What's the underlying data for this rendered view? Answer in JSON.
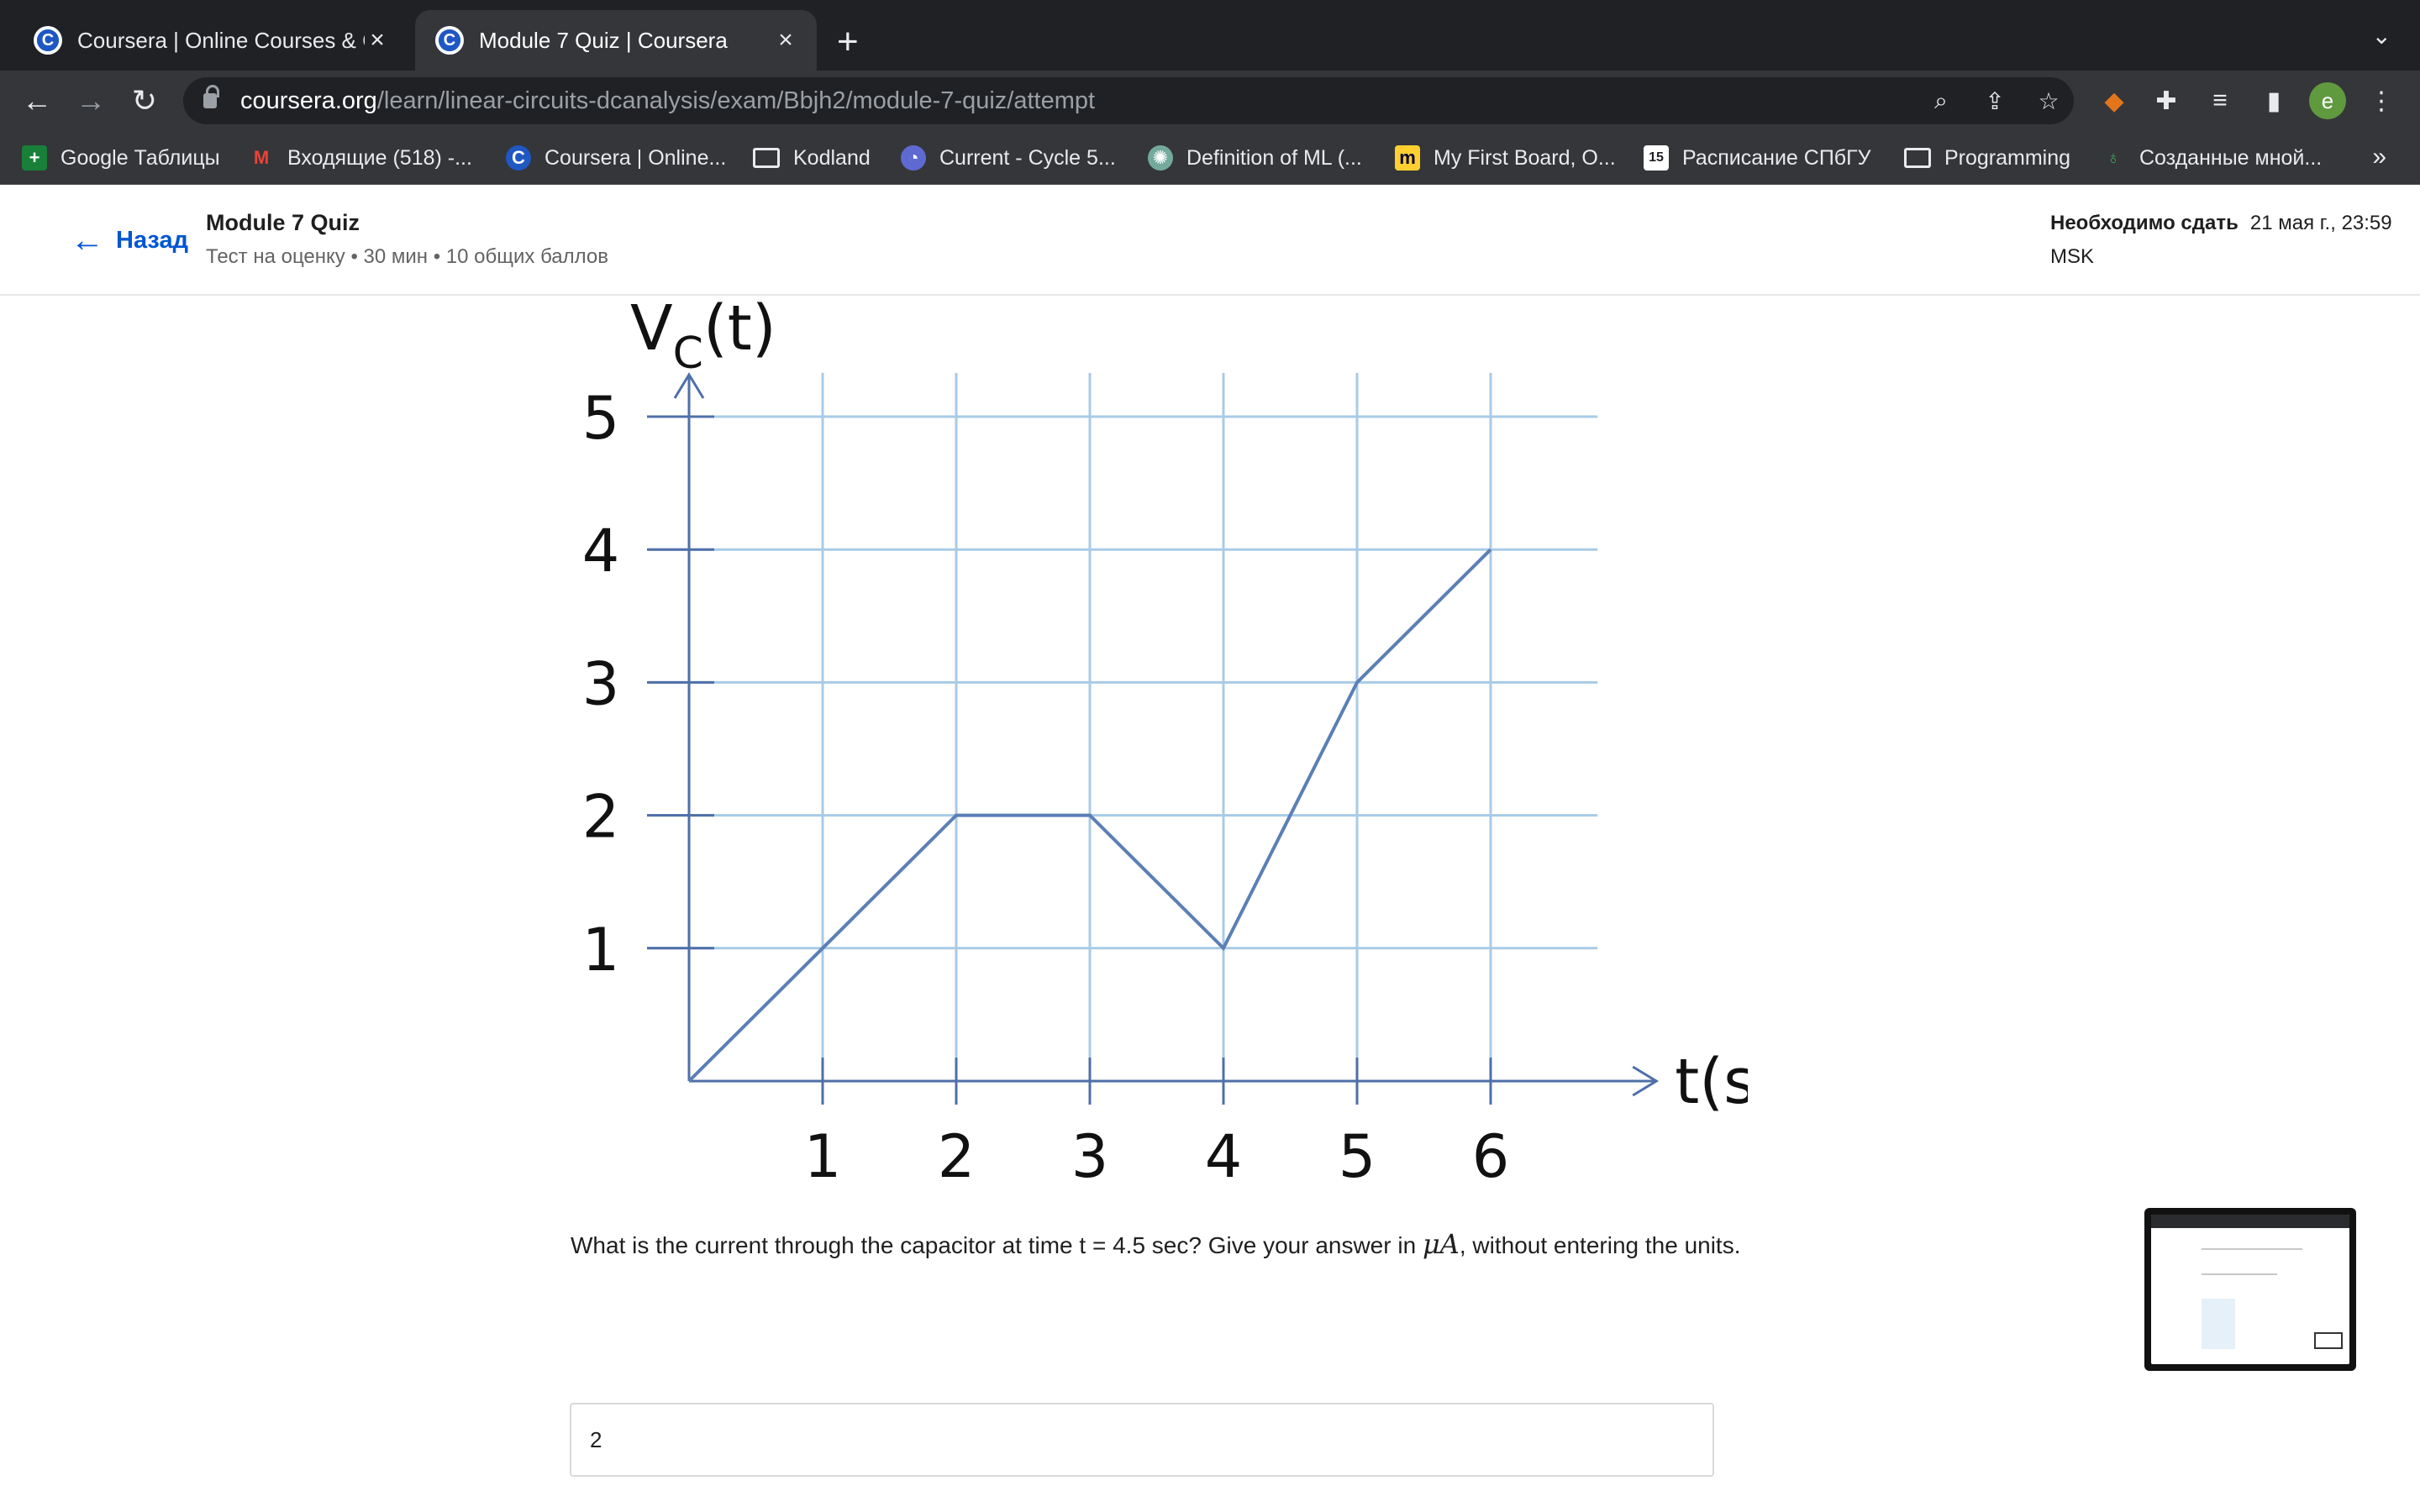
{
  "browser": {
    "tabs": [
      {
        "title": "Coursera | Online Courses & Cr",
        "active": false,
        "favicon": "coursera-icon"
      },
      {
        "title": "Module 7 Quiz | Coursera",
        "active": true,
        "favicon": "coursera-icon"
      }
    ],
    "new_tab_label": "+",
    "url_host": "coursera.org",
    "url_path": "/learn/linear-circuits-dcanalysis/exam/Bbjh2/module-7-quiz/attempt",
    "profile_initial": "e",
    "bookmarks": [
      {
        "label": "Google Таблицы",
        "icon": "sheets-icon"
      },
      {
        "label": "Входящие (518) -...",
        "icon": "gmail-icon"
      },
      {
        "label": "Coursera | Online...",
        "icon": "coursera-icon"
      },
      {
        "label": "Kodland",
        "icon": "folder-icon"
      },
      {
        "label": "Current - Cycle 5...",
        "icon": "linear-icon"
      },
      {
        "label": "Definition of ML (...",
        "icon": "openai-icon"
      },
      {
        "label": "My First Board, O...",
        "icon": "miro-icon"
      },
      {
        "label": "Расписание СПбГУ",
        "icon": "calendar-icon"
      },
      {
        "label": "Programming",
        "icon": "folder-icon"
      },
      {
        "label": "Созданные мной...",
        "icon": "leaf-icon"
      }
    ],
    "bookmarks_more": "»"
  },
  "header": {
    "back_label": "Назад",
    "quiz_title": "Module 7 Quiz",
    "quiz_meta": "Тест на оценку • 30 мин • 10 общих баллов",
    "due_label": "Необходимо сдать",
    "due_date": "21 мая г., 23:59",
    "due_tz": "MSK"
  },
  "question": {
    "text_before": "What is the current through the capacitor at time t = 4.5 sec?  Give your answer in ",
    "math": "μA",
    "text_after": ", without entering the units.",
    "answer_value": "2"
  },
  "chart_data": {
    "type": "line",
    "ylabel_main": "V",
    "ylabel_sub": "C",
    "ylabel_tail": "(t)",
    "xlabel": "t(s)",
    "x_ticks": [
      "1",
      "2",
      "3",
      "4",
      "5",
      "6"
    ],
    "y_ticks": [
      "1",
      "2",
      "3",
      "4",
      "5"
    ],
    "xlim": [
      0,
      6.8
    ],
    "ylim": [
      0,
      5
    ],
    "grid": true,
    "x": [
      0,
      1,
      2,
      3,
      4,
      5,
      6
    ],
    "y": [
      0,
      1,
      2,
      2,
      1,
      3,
      4
    ],
    "colors": {
      "line": "#5b7fb5",
      "grid": "#a8cbe6",
      "axis": "#4f6fa8",
      "text": "#111111"
    }
  }
}
